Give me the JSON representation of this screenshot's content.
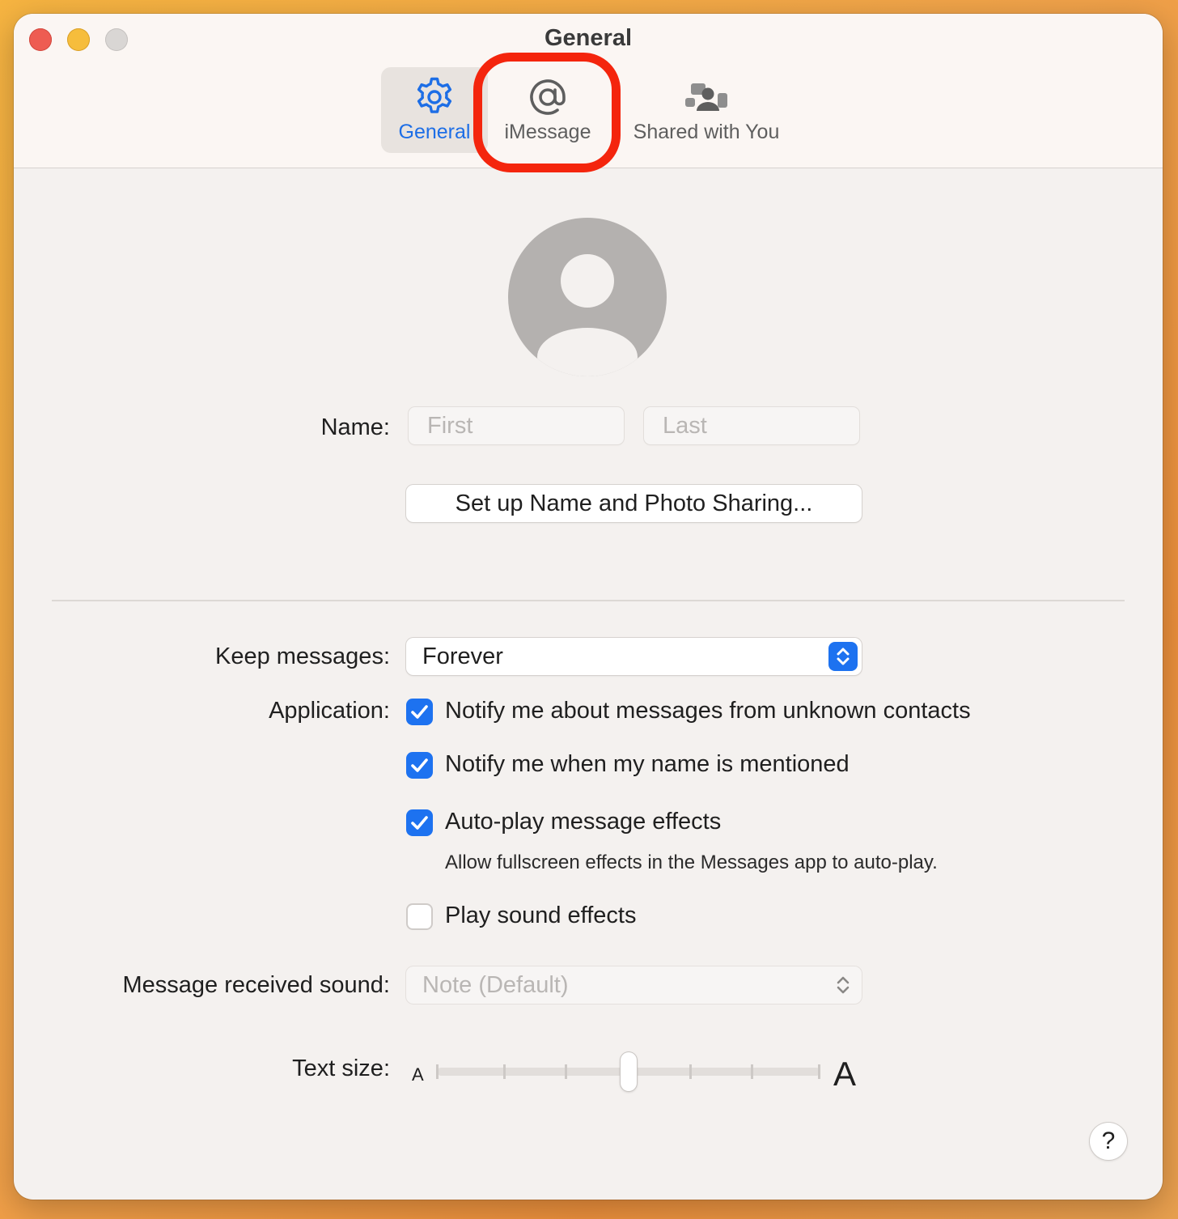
{
  "window": {
    "title": "General"
  },
  "toolbar": {
    "tabs": [
      {
        "label": "General",
        "icon": "gear-icon",
        "selected": true
      },
      {
        "label": "iMessage",
        "icon": "at-sign-icon",
        "selected": false
      },
      {
        "label": "Shared with You",
        "icon": "shared-with-you-icon",
        "selected": false
      }
    ],
    "highlighted_tab": "iMessage"
  },
  "profile": {
    "avatar_icon": "person-placeholder-icon",
    "name_label": "Name:",
    "first_placeholder": "First",
    "last_placeholder": "Last",
    "setup_button": "Set up Name and Photo Sharing..."
  },
  "settings": {
    "keep_messages": {
      "label": "Keep messages:",
      "value": "Forever"
    },
    "application": {
      "label": "Application:",
      "options": [
        {
          "label": "Notify me about messages from unknown contacts",
          "checked": true
        },
        {
          "label": "Notify me when my name is mentioned",
          "checked": true
        },
        {
          "label": "Auto-play message effects",
          "checked": true,
          "description": "Allow fullscreen effects in the Messages app to auto-play."
        },
        {
          "label": "Play sound effects",
          "checked": false
        }
      ]
    },
    "received_sound": {
      "label": "Message received sound:",
      "value": "Note (Default)",
      "enabled": false
    },
    "text_size": {
      "label": "Text size:",
      "small_glyph": "A",
      "large_glyph": "A",
      "steps": 7,
      "current_step": 4
    }
  },
  "help": {
    "glyph": "?"
  },
  "colors": {
    "accent": "#1d72f0",
    "highlight_ring": "#f4250d",
    "close": "#ee5c52",
    "minimize": "#f6bd3c",
    "zoom_disabled": "#d9d6d4"
  }
}
